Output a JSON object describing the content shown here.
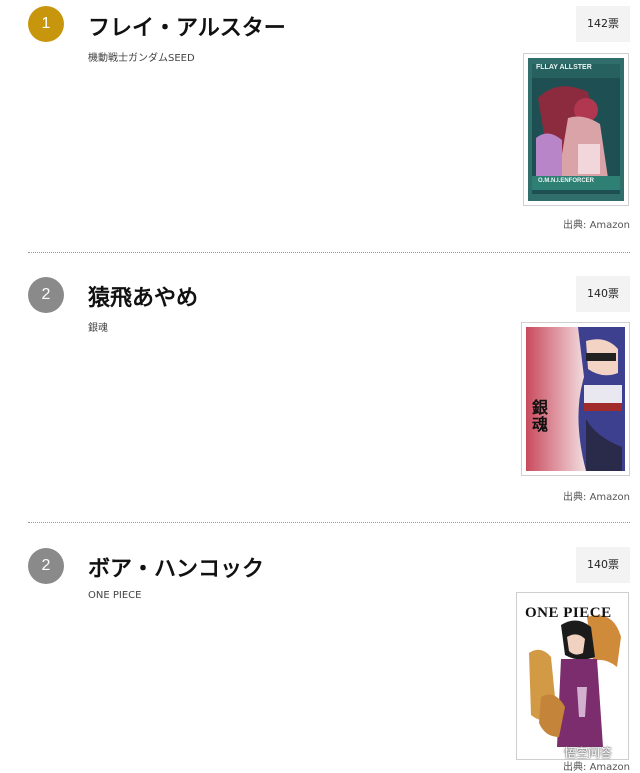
{
  "entries": [
    {
      "rank": "1",
      "rank_color": "#c8960c",
      "name": "フレイ・アルスター",
      "series": "機動戦士ガンダムSEED",
      "votes": "142票",
      "cover_text_top": "FLLAY ALLSTER",
      "cover_text_bottom": "O.M.N.I.ENFORCER",
      "source": "出典: Amazon"
    },
    {
      "rank": "2",
      "rank_color": "#8a8a8a",
      "name": "猿飛あやめ",
      "series": "銀魂",
      "votes": "140票",
      "cover_text_top": "銀魂",
      "cover_text_bottom": "",
      "source": "出典: Amazon"
    },
    {
      "rank": "2",
      "rank_color": "#8a8a8a",
      "name": "ボア・ハンコック",
      "series": "ONE PIECE",
      "votes": "140票",
      "cover_text_top": "ONE PIECE",
      "cover_text_bottom": "",
      "source": "出典: Amazon"
    }
  ],
  "watermark": "悟空问答"
}
